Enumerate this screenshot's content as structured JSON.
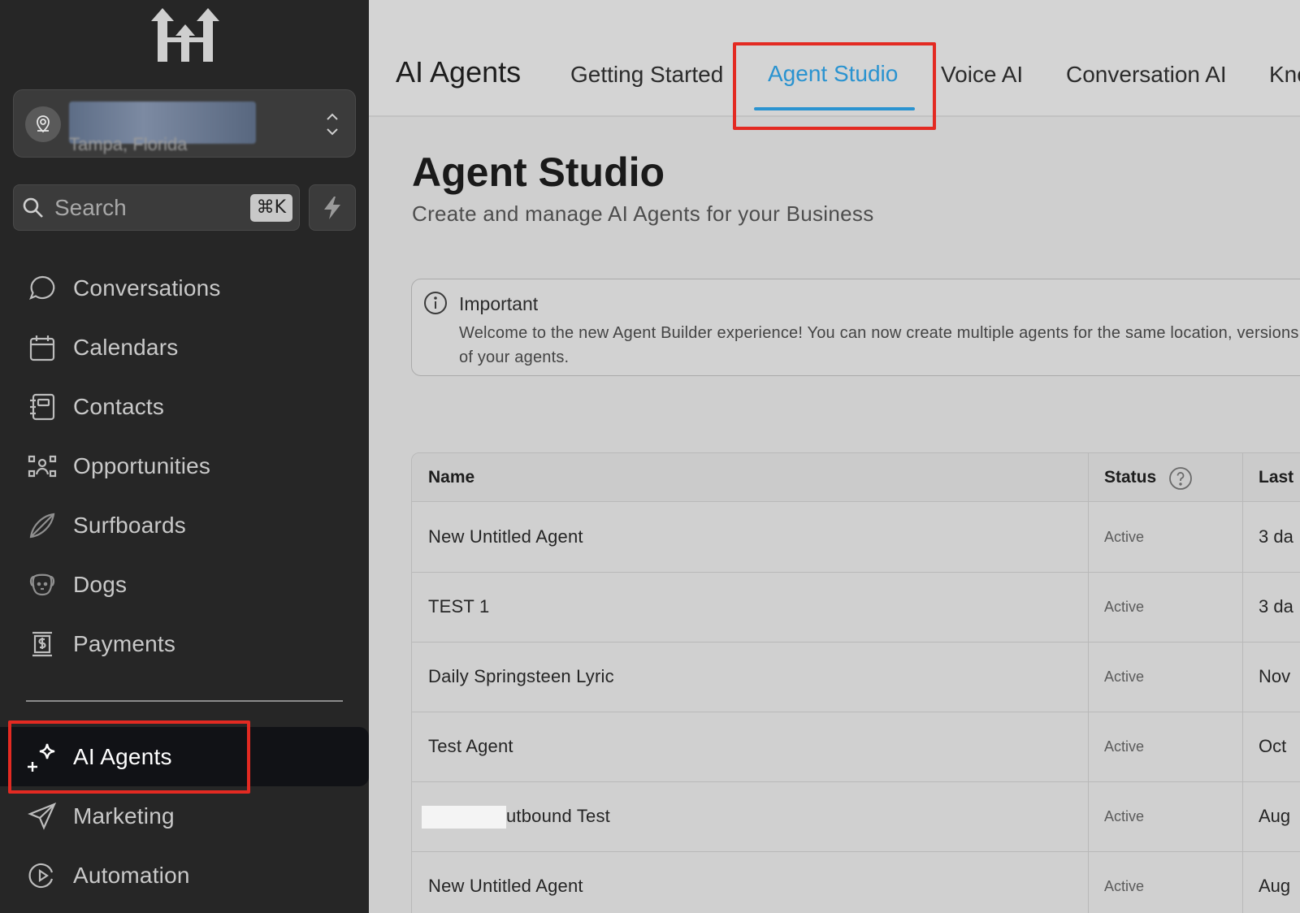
{
  "sidebar": {
    "logo_icon": "brand-arrows-logo",
    "location_icon": "location-pin-icon",
    "location_subtitle": "Tampa, Florida",
    "search": {
      "placeholder": "Search",
      "shortcut": "⌘K"
    },
    "quick_action_icon": "lightning-bolt-icon",
    "nav_items": [
      {
        "label": "Conversations",
        "icon": "chat-bubble-icon"
      },
      {
        "label": "Calendars",
        "icon": "calendar-icon"
      },
      {
        "label": "Contacts",
        "icon": "contacts-book-icon"
      },
      {
        "label": "Opportunities",
        "icon": "opportunities-icon"
      },
      {
        "label": "Surfboards",
        "icon": "surfboard-icon"
      },
      {
        "label": "Dogs",
        "icon": "dog-icon"
      },
      {
        "label": "Payments",
        "icon": "payments-icon"
      }
    ],
    "nav_items_2": [
      {
        "label": "AI Agents",
        "icon": "sparkles-icon",
        "active": true
      },
      {
        "label": "Marketing",
        "icon": "paper-plane-icon"
      },
      {
        "label": "Automation",
        "icon": "play-circle-icon"
      }
    ]
  },
  "header": {
    "app_title": "AI Agents",
    "tabs": [
      {
        "label": "Getting Started"
      },
      {
        "label": "Agent Studio",
        "active": true
      },
      {
        "label": "Voice AI"
      },
      {
        "label": "Conversation AI"
      },
      {
        "label": "Kno"
      }
    ]
  },
  "page": {
    "title": "Agent Studio",
    "subtitle": "Create and manage AI Agents for your Business"
  },
  "alert": {
    "icon": "info-icon",
    "title": "Important",
    "body": "Welcome to the new Agent Builder experience! You can now create multiple agents for the same location, versions of your agents."
  },
  "table": {
    "columns": [
      "Name",
      "Status",
      "Last"
    ],
    "status_help_icon": "question-circle-icon",
    "rows": [
      {
        "name": "New Untitled Agent",
        "status": "Active",
        "last": "3 da"
      },
      {
        "name": "TEST 1",
        "status": "Active",
        "last": "3 da"
      },
      {
        "name": "Daily Springsteen Lyric",
        "status": "Active",
        "last": "Nov"
      },
      {
        "name": "Test Agent",
        "status": "Active",
        "last": "Oct"
      },
      {
        "name": "utbound Test",
        "status": "Active",
        "last": "Aug"
      },
      {
        "name": "New Untitled Agent",
        "status": "Active",
        "last": "Aug"
      }
    ]
  },
  "colors": {
    "sidebar_bg": "#262626",
    "accent_blue": "#2a93d0",
    "highlight_red": "#e32a22"
  }
}
